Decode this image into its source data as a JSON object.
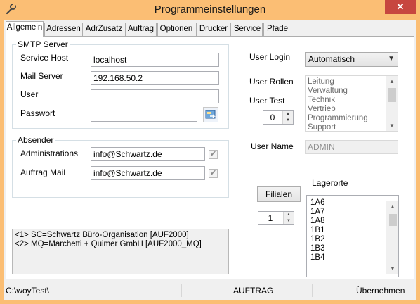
{
  "window": {
    "title": "Programmeinstellungen",
    "close_symbol": "✕"
  },
  "tabs": [
    {
      "label": "Allgemein",
      "active": true
    },
    {
      "label": "Adressen"
    },
    {
      "label": "AdrZusatz"
    },
    {
      "label": "Auftrag"
    },
    {
      "label": "Optionen"
    },
    {
      "label": "Drucker"
    },
    {
      "label": "Service"
    },
    {
      "label": "Pfade"
    }
  ],
  "smtp": {
    "title": "SMTP Server",
    "service_host_label": "Service Host",
    "service_host_value": "localhost",
    "mail_server_label": "Mail Server",
    "mail_server_value": "192.168.50.2",
    "user_label": "User",
    "user_value": "",
    "password_label": "Passwort",
    "password_value": ""
  },
  "sender": {
    "title": "Absender",
    "admin_label": "Administrations",
    "admin_value": "info@Schwartz.de",
    "admin_checked": true,
    "order_label": "Auftrag Mail",
    "order_value": "info@Schwartz.de",
    "order_checked": true
  },
  "companies": [
    "<1> SC=Schwartz Büro-Organisation [AUF2000]",
    "<2> MQ=Marchetti + Quimer GmbH [AUF2000_MQ]"
  ],
  "user_login": {
    "label": "User Login",
    "value": "Automatisch"
  },
  "user_roles": {
    "label": "User Rollen",
    "items": [
      "Leitung",
      "Verwaltung",
      "Technik",
      "Vertrieb",
      "Programmierung",
      "Support"
    ]
  },
  "user_test": {
    "label": "User Test",
    "value": "0"
  },
  "user_name": {
    "label": "User Name",
    "value": "ADMIN"
  },
  "branches_button": "Filialen",
  "branches_counter": "1",
  "storage": {
    "label": "Lagerorte",
    "items": [
      "1A6",
      "1A7",
      "1A8",
      "1B1",
      "1B2",
      "1B3",
      "1B4"
    ]
  },
  "status": {
    "path": "C:\\woyTest\\",
    "mode": "AUFTRAG",
    "apply": "Übernehmen"
  },
  "icons": {
    "app": "wrench-icon",
    "password_tool": "key-settings-icon"
  }
}
